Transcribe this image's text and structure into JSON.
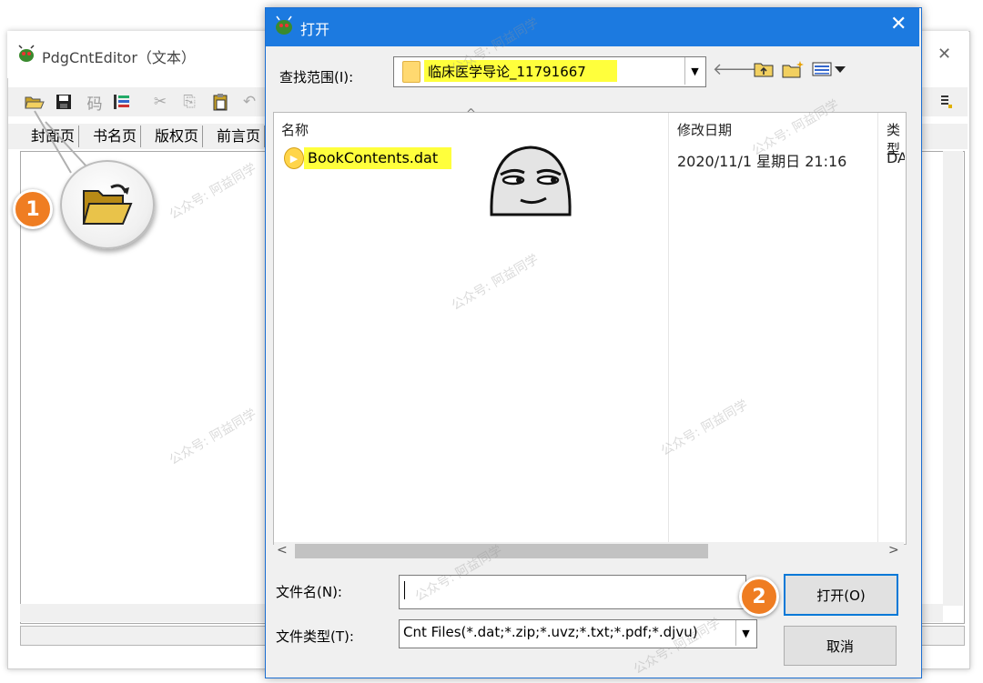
{
  "background_window": {
    "title": "PdgCntEditor（文本）",
    "close_glyph": "✕",
    "toolbar": [
      "open-folder-icon",
      "save-icon",
      "码",
      "list-icon",
      "cut-icon",
      "copy-icon",
      "paste-icon",
      "undo-icon"
    ],
    "code_label": "码",
    "tabs": [
      "封面页",
      "书名页",
      "版权页",
      "前言页"
    ]
  },
  "annotations": {
    "step1": "1",
    "step2": "2"
  },
  "dialog": {
    "title": "打开",
    "close_glyph": "✕",
    "lookin_label": "查找范围(I):",
    "lookin_value": "临床医学导论_11791667",
    "columns": {
      "name": "名称",
      "modified": "修改日期",
      "type": "类型"
    },
    "files": [
      {
        "name": "BookContents.dat",
        "modified": "2020/11/1 星期日 21:16",
        "type": "DA"
      }
    ],
    "filename_label": "文件名(N):",
    "filename_value": "",
    "filetype_label": "文件类型(T):",
    "filetype_value": "Cnt Files(*.dat;*.zip;*.uvz;*.txt;*.pdf;*.djvu)",
    "open_button": "打开(O)",
    "cancel_button": "取消"
  },
  "watermark": "公众号: 阿益同学",
  "colors": {
    "titlebar": "#1c7ae0",
    "highlight": "#ffff3c",
    "badge": "#ef7d22"
  }
}
